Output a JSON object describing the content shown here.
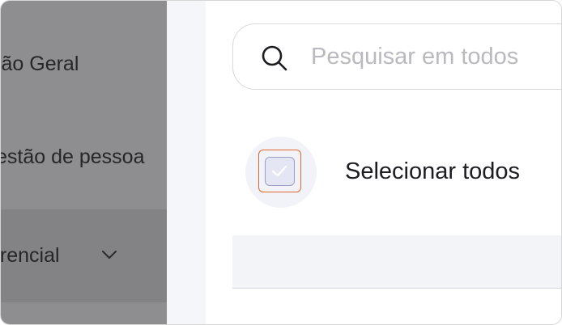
{
  "sidebar": {
    "items": [
      {
        "label": "são Geral"
      },
      {
        "label": "estão de pessoa"
      },
      {
        "label": "erencial"
      }
    ]
  },
  "search": {
    "placeholder": "Pesquisar em todos",
    "value": ""
  },
  "selection": {
    "select_all_label": "Selecionar todos",
    "checked": true
  },
  "colors": {
    "sidebar_bg": "#8e8d8f",
    "focus_outline": "#e0672f",
    "checkbox_fill": "#e4e6f3"
  },
  "icons": [
    "search-icon",
    "chevron-down-icon",
    "check-icon"
  ]
}
